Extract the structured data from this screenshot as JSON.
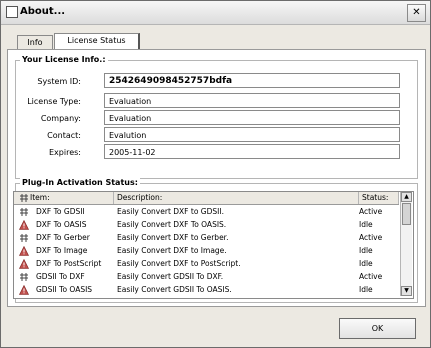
{
  "window": {
    "title": "About..."
  },
  "tabs": [
    "Info",
    "License Status"
  ],
  "license": {
    "group_title": "Your License Info.:",
    "fields": [
      {
        "label": "System ID:",
        "value": "2542649098452757bdfa"
      },
      {
        "label": "License Type:",
        "value": "Evaluation"
      },
      {
        "label": "Company:",
        "value": "Evaluation"
      },
      {
        "label": "Contact:",
        "value": "Evalution"
      },
      {
        "label": "Expires:",
        "value": "2005-11-02"
      }
    ]
  },
  "plugins": {
    "group_title": "Plug-In Activation Status:",
    "columns": [
      "Item:",
      "Description:",
      "Status:"
    ],
    "rows": [
      {
        "icon": "plugin-active-icon",
        "item": "DXF To GDSII",
        "description": "Easily Convert DXF to GDSII.",
        "status": "Active"
      },
      {
        "icon": "warning-icon",
        "item": "DXF To OASIS",
        "description": "Easily Convert DXF To OASIS.",
        "status": "Idle"
      },
      {
        "icon": "plugin-active-icon",
        "item": "DXF To Gerber",
        "description": "Easily Convert DXF to Gerber.",
        "status": "Active"
      },
      {
        "icon": "warning-icon",
        "item": "DXF To Image",
        "description": "Easily Convert DXF to Image.",
        "status": "Idle"
      },
      {
        "icon": "warning-icon",
        "item": "DXF To PostScript",
        "description": "Easily Convert DXF to PostScript.",
        "status": "Idle"
      },
      {
        "icon": "plugin-active-icon",
        "item": "GDSII To DXF",
        "description": "Easily Convert GDSII To DXF.",
        "status": "Active"
      },
      {
        "icon": "warning-icon",
        "item": "GDSII To OASIS",
        "description": "Easily Convert GDSII To OASIS.",
        "status": "Idle"
      }
    ]
  },
  "buttons": {
    "ok": "OK"
  }
}
